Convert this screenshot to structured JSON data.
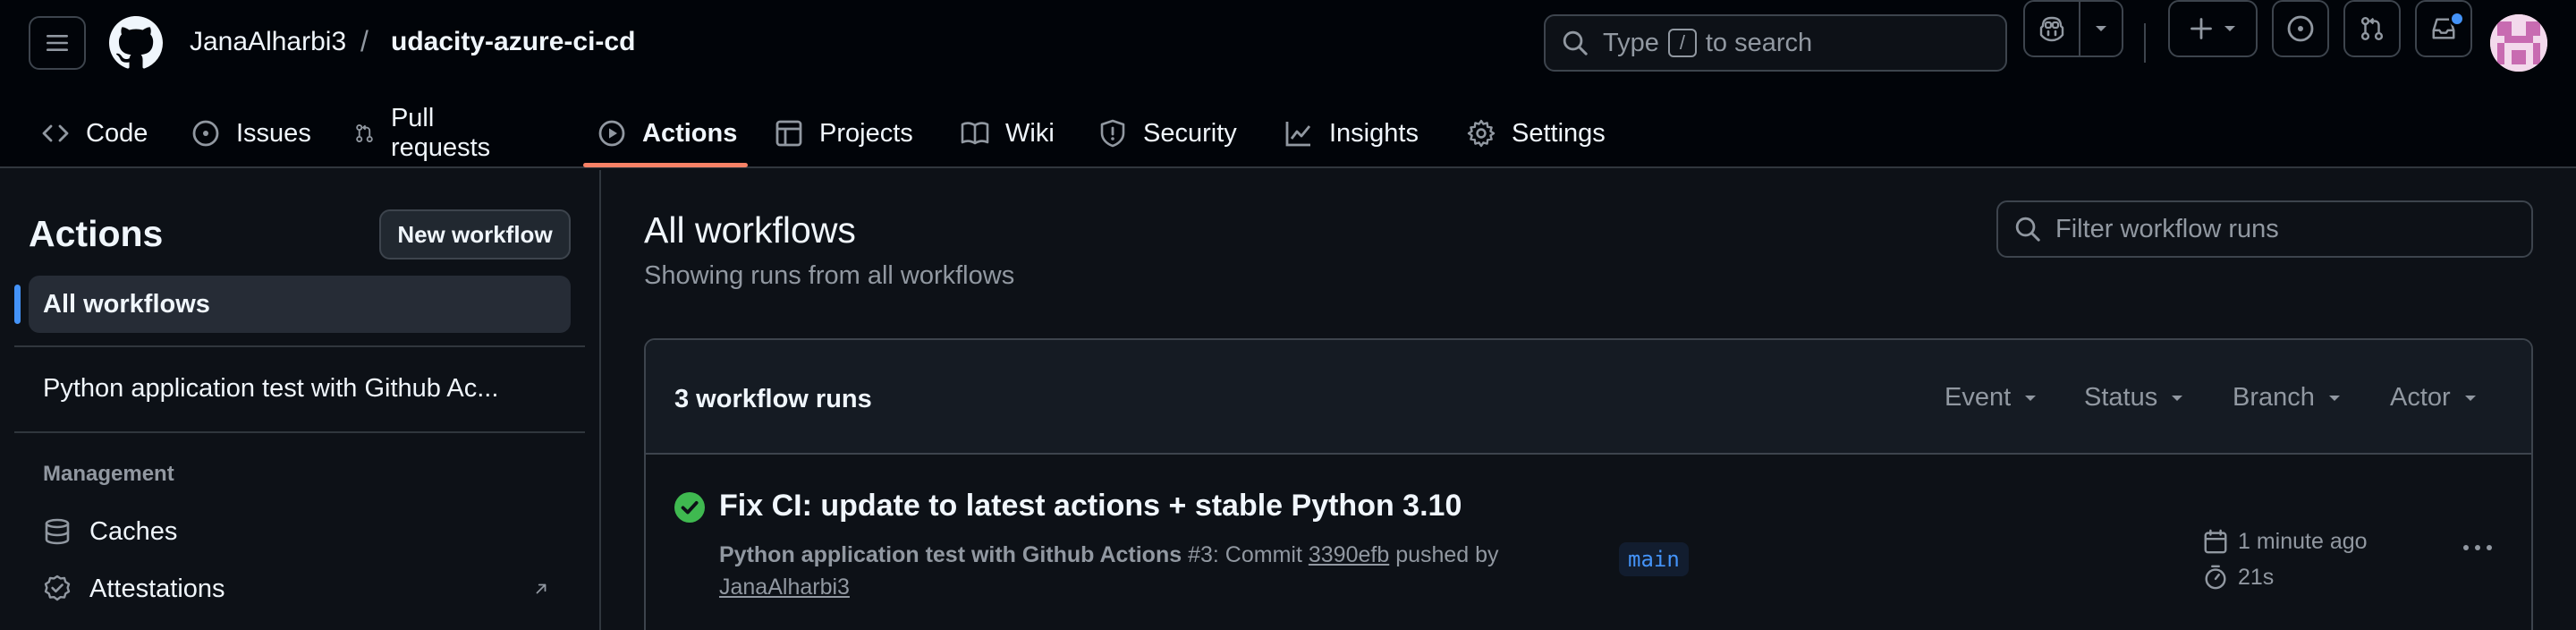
{
  "header": {
    "owner": "JanaAlharbi3",
    "separator": "/",
    "repo": "udacity-azure-ci-cd",
    "search": {
      "prefix": "Type",
      "key": "/",
      "suffix": "to search"
    },
    "icons": [
      "menu-icon",
      "github-logo",
      "search-icon",
      "copilot-icon",
      "plus-icon",
      "issue-icon",
      "pull-request-icon",
      "inbox-icon"
    ],
    "has_unread_notifications": true
  },
  "tabs": [
    {
      "label": "Code",
      "icon": "code-icon"
    },
    {
      "label": "Issues",
      "icon": "issue-icon"
    },
    {
      "label": "Pull requests",
      "icon": "pull-request-icon"
    },
    {
      "label": "Actions",
      "icon": "play-icon",
      "active": true
    },
    {
      "label": "Projects",
      "icon": "table-icon"
    },
    {
      "label": "Wiki",
      "icon": "book-icon"
    },
    {
      "label": "Security",
      "icon": "shield-icon"
    },
    {
      "label": "Insights",
      "icon": "graph-icon"
    },
    {
      "label": "Settings",
      "icon": "gear-icon"
    }
  ],
  "sidebar": {
    "title": "Actions",
    "new_workflow": "New workflow",
    "all_workflows": "All workflows",
    "workflows": [
      "Python application test with Github Ac..."
    ],
    "management_heading": "Management",
    "management": [
      {
        "label": "Caches",
        "icon": "database-icon"
      },
      {
        "label": "Attestations",
        "icon": "verified-icon"
      }
    ]
  },
  "main": {
    "title": "All workflows",
    "subtitle": "Showing runs from all workflows",
    "filter_placeholder": "Filter workflow runs",
    "runs_count": "3 workflow runs",
    "filters": [
      "Event",
      "Status",
      "Branch",
      "Actor"
    ],
    "runs": [
      {
        "status": "success",
        "title": "Fix CI: update to latest actions + stable Python 3.10",
        "workflow": "Python application test with Github Actions",
        "run_number": "#3",
        "commit_prefix": ": Commit",
        "commit": "3390efb",
        "pushed_by": "pushed by",
        "actor": "JanaAlharbi3",
        "branch": "main",
        "time": "1 minute ago",
        "duration": "21s"
      }
    ]
  },
  "colors": {
    "background": "#0d1117",
    "header": "#010409",
    "accent_underline": "#f78166",
    "link_blue": "#4493f8",
    "success_green": "#3fb950"
  }
}
